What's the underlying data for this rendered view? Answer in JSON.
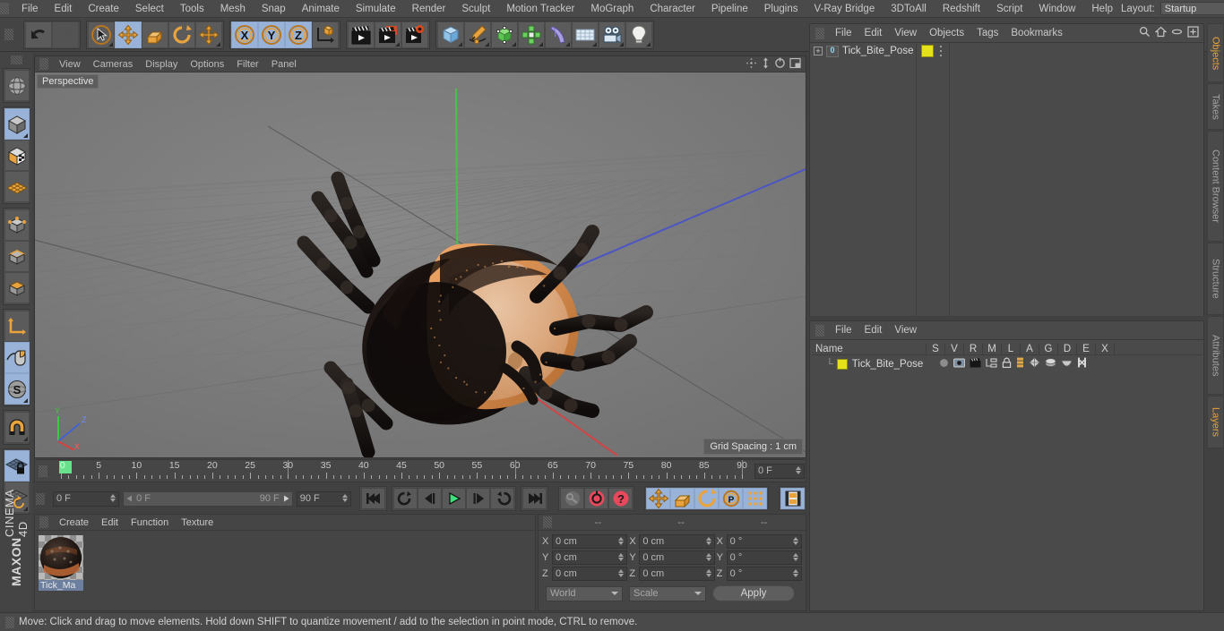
{
  "app": {
    "title": "MAXON CINEMA 4D",
    "brand_line1": "MAXON",
    "brand_line2": "CINEMA 4D"
  },
  "top_menu": {
    "items": [
      {
        "label": "File"
      },
      {
        "label": "Edit"
      },
      {
        "label": "Create"
      },
      {
        "label": "Select"
      },
      {
        "label": "Tools"
      },
      {
        "label": "Mesh"
      },
      {
        "label": "Snap"
      },
      {
        "label": "Animate"
      },
      {
        "label": "Simulate"
      },
      {
        "label": "Render"
      },
      {
        "label": "Sculpt"
      },
      {
        "label": "Motion Tracker"
      },
      {
        "label": "MoGraph"
      },
      {
        "label": "Character"
      },
      {
        "label": "Pipeline"
      },
      {
        "label": "Plugins"
      },
      {
        "label": "V-Ray Bridge"
      },
      {
        "label": "3DToAll"
      },
      {
        "label": "Redshift"
      },
      {
        "label": "Script"
      },
      {
        "label": "Window"
      },
      {
        "label": "Help"
      }
    ],
    "layout_label": "Layout:",
    "layout_value": "Startup",
    "search_icon": "magnifier-icon"
  },
  "toolbar": {
    "groups": [
      {
        "name": "history",
        "buttons": [
          {
            "name": "undo-button",
            "icon": "undo-arrow-icon",
            "active": false,
            "enabled": true,
            "corner": false
          },
          {
            "name": "redo-button",
            "icon": "redo-arrow-icon",
            "active": false,
            "enabled": false,
            "corner": false
          }
        ]
      },
      {
        "name": "transform-tools",
        "buttons": [
          {
            "name": "live-selection-tool",
            "icon": "cursor-circle-icon",
            "active": false,
            "enabled": true,
            "corner": true
          },
          {
            "name": "move-tool",
            "icon": "move-cross-icon",
            "active": true,
            "enabled": true,
            "corner": false
          },
          {
            "name": "scale-tool",
            "icon": "scale-box-icon",
            "active": false,
            "enabled": true,
            "corner": false
          },
          {
            "name": "rotate-tool",
            "icon": "rotate-circle-icon",
            "active": false,
            "enabled": true,
            "corner": false
          },
          {
            "name": "free-move-tool",
            "icon": "move-cross-icon",
            "active": false,
            "enabled": true,
            "corner": true
          }
        ]
      },
      {
        "name": "axis-locks",
        "buttons": [
          {
            "name": "lock-x-axis",
            "icon": "x-axis-icon",
            "active": true,
            "enabled": true,
            "corner": false
          },
          {
            "name": "lock-y-axis",
            "icon": "y-axis-icon",
            "active": true,
            "enabled": true,
            "corner": false
          },
          {
            "name": "lock-z-axis",
            "icon": "z-axis-icon",
            "active": true,
            "enabled": true,
            "corner": false
          },
          {
            "name": "world-object-coordinates",
            "icon": "axis-cube-icon",
            "active": false,
            "enabled": true,
            "corner": false
          }
        ]
      },
      {
        "name": "render-tools",
        "buttons": [
          {
            "name": "render-view-button",
            "icon": "clapboard-icon",
            "active": false,
            "enabled": true,
            "corner": false
          },
          {
            "name": "render-to-picture-viewer-button",
            "icon": "clapboard-window-icon",
            "active": false,
            "enabled": true,
            "corner": true
          },
          {
            "name": "render-settings-button",
            "icon": "clapboard-gear-icon",
            "active": false,
            "enabled": true,
            "corner": false
          }
        ]
      },
      {
        "name": "object-creation",
        "buttons": [
          {
            "name": "add-cube-button",
            "icon": "blue-cube-icon",
            "active": false,
            "enabled": true,
            "corner": true
          },
          {
            "name": "add-spline-button",
            "icon": "pen-spline-icon",
            "active": false,
            "enabled": true,
            "corner": true
          },
          {
            "name": "add-generator-button",
            "icon": "green-cube-icon",
            "active": false,
            "enabled": true,
            "corner": true
          },
          {
            "name": "add-array-button",
            "icon": "green-array-icon",
            "active": false,
            "enabled": true,
            "corner": true
          },
          {
            "name": "add-deformer-button",
            "icon": "bend-deformer-icon",
            "active": false,
            "enabled": true,
            "corner": true
          },
          {
            "name": "add-environment-button",
            "icon": "floor-grid-icon",
            "active": false,
            "enabled": true,
            "corner": true
          },
          {
            "name": "add-camera-button",
            "icon": "camera-icon",
            "active": false,
            "enabled": true,
            "corner": true
          },
          {
            "name": "add-light-button",
            "icon": "light-bulb-icon",
            "active": false,
            "enabled": true,
            "corner": true
          }
        ]
      }
    ]
  },
  "left_toolbar": {
    "groups": [
      {
        "name": "view-group",
        "buttons": [
          {
            "name": "make-editable-button",
            "icon": "globe-wire-icon",
            "active": false,
            "corner": false
          }
        ]
      },
      {
        "name": "mode-group",
        "buttons": [
          {
            "name": "model-mode-button",
            "icon": "grey-cube-icon",
            "active": true,
            "corner": true
          },
          {
            "name": "texture-mode-button",
            "icon": "checker-cube-icon",
            "active": false,
            "corner": false
          },
          {
            "name": "workplane-mode-button",
            "icon": "orange-grid-icon",
            "active": false,
            "corner": false
          }
        ]
      },
      {
        "name": "component-group",
        "buttons": [
          {
            "name": "points-mode-button",
            "icon": "cube-points-icon",
            "active": false,
            "corner": false
          },
          {
            "name": "edges-mode-button",
            "icon": "cube-edges-icon",
            "active": false,
            "corner": false
          },
          {
            "name": "polygons-mode-button",
            "icon": "cube-polygons-icon",
            "active": false,
            "corner": false
          }
        ]
      },
      {
        "name": "axis-group",
        "buttons": [
          {
            "name": "enable-axis-button",
            "icon": "axis-L-icon",
            "active": false,
            "corner": false
          },
          {
            "name": "enable-snapping-button",
            "icon": "mouse-icon",
            "active": true,
            "corner": false
          },
          {
            "name": "soft-selection-button",
            "icon": "s-sphere-icon",
            "active": true,
            "corner": true
          }
        ]
      },
      {
        "name": "snap-group",
        "buttons": [
          {
            "name": "magnet-tool-button",
            "icon": "magnet-icon",
            "active": false,
            "corner": true
          }
        ]
      },
      {
        "name": "workplane-group",
        "buttons": [
          {
            "name": "lock-workplane-button",
            "icon": "grid-lock-icon",
            "active": true,
            "corner": false
          },
          {
            "name": "planar-workplane-button",
            "icon": "grid-rotate-icon",
            "active": false,
            "corner": true
          }
        ]
      }
    ]
  },
  "viewport": {
    "menu": [
      {
        "label": "View"
      },
      {
        "label": "Cameras"
      },
      {
        "label": "Display"
      },
      {
        "label": "Options"
      },
      {
        "label": "Filter"
      },
      {
        "label": "Panel"
      }
    ],
    "icons": [
      "move-view-icon",
      "zoom-view-icon",
      "rotate-view-icon",
      "maximize-view-icon"
    ],
    "camera_label": "Perspective",
    "grid_spacing": "Grid Spacing : 1 cm",
    "axis_gizmo": {
      "x": "X",
      "y": "Y",
      "z": "Z",
      "x_color": "#e23b3b",
      "y_color": "#3bcf3b",
      "z_color": "#3b5fe2"
    },
    "scene_object": "Tick_Bite_Pose",
    "colors": {
      "background": "#7d7d7d",
      "grid_line": "#6f6f6f",
      "axis_x": "#d04545",
      "axis_y": "#4bbf4b",
      "axis_z": "#4b55c4",
      "body_dark": "#1a1413",
      "shield_orange": "#e3a06c",
      "shield_light": "#d9b394",
      "leg_dark": "#1c1716"
    }
  },
  "timeline": {
    "ticks": [
      0,
      5,
      10,
      15,
      20,
      25,
      30,
      35,
      40,
      45,
      50,
      55,
      60,
      65,
      70,
      75,
      80,
      85,
      90
    ],
    "min_frame": 0,
    "max_frame": 90,
    "current_frame_value": "0 F",
    "playhead_frame": 0,
    "end_field": "0 F"
  },
  "transport": {
    "current_frame": "0 F",
    "range_start": "0 F",
    "range_end": "90 F",
    "preview_end": "90 F",
    "buttons": [
      {
        "name": "go-to-start-button",
        "icon": "skip-start-icon",
        "active": false
      },
      {
        "name": "go-to-previous-keyframe-button",
        "icon": "prev-key-icon",
        "active": false
      },
      {
        "name": "step-back-button",
        "icon": "step-back-icon",
        "active": false
      },
      {
        "name": "play-button",
        "icon": "play-icon",
        "active": false
      },
      {
        "name": "step-forward-button",
        "icon": "step-forward-icon",
        "active": false
      },
      {
        "name": "go-to-next-keyframe-button",
        "icon": "next-key-icon",
        "active": false
      },
      {
        "name": "go-to-end-button",
        "icon": "skip-end-icon",
        "active": false
      }
    ],
    "key_buttons": [
      {
        "name": "record-active-objects-button",
        "icon": "key-icon",
        "active": false
      },
      {
        "name": "autokeying-button",
        "icon": "red-circle-arrow-icon",
        "active": false
      },
      {
        "name": "keyframe-selection-button",
        "icon": "red-question-icon",
        "active": false
      }
    ],
    "channel_buttons": [
      {
        "name": "record-position-button",
        "icon": "move-cross-icon",
        "active": true
      },
      {
        "name": "record-scale-button",
        "icon": "scale-box-icon",
        "active": true
      },
      {
        "name": "record-rotation-button",
        "icon": "rotate-circle-icon",
        "active": true
      },
      {
        "name": "record-parameter-button",
        "icon": "p-circle-icon",
        "active": true
      },
      {
        "name": "record-pla-button",
        "icon": "dots-grid-icon",
        "active": true
      },
      {
        "name": "keyframe-mode-button",
        "icon": "film-strip-icon",
        "active": true
      }
    ]
  },
  "materials": {
    "menu": [
      {
        "label": "Create"
      },
      {
        "label": "Edit"
      },
      {
        "label": "Function"
      },
      {
        "label": "Texture"
      }
    ],
    "items": [
      {
        "name": "Tick_Ma",
        "selected": true
      }
    ]
  },
  "coordinates": {
    "headers": [
      "--",
      "--",
      "--"
    ],
    "rows": [
      {
        "axis": "X",
        "position": "0 cm",
        "size": "0 cm",
        "rotation": "0 °"
      },
      {
        "axis": "Y",
        "position": "0 cm",
        "size": "0 cm",
        "rotation": "0 °"
      },
      {
        "axis": "Z",
        "position": "0 cm",
        "size": "0 cm",
        "rotation": "0 °"
      }
    ],
    "coord_system": "World",
    "transform_mode": "Scale",
    "apply_label": "Apply"
  },
  "objects_panel": {
    "menu": [
      {
        "label": "File"
      },
      {
        "label": "Edit"
      },
      {
        "label": "View"
      },
      {
        "label": "Objects"
      },
      {
        "label": "Tags"
      },
      {
        "label": "Bookmarks"
      }
    ],
    "icons": [
      "magnifier-icon",
      "home-icon",
      "ellipse-icon",
      "plus-box-icon"
    ],
    "rows": [
      {
        "name": "Tick_Bite_Pose",
        "icon_badge": "0",
        "tag_color": "#e5e21b",
        "expanded": false
      }
    ]
  },
  "layers_panel": {
    "menu": [
      {
        "label": "File"
      },
      {
        "label": "Edit"
      },
      {
        "label": "View"
      }
    ],
    "columns": [
      "Name",
      "S",
      "V",
      "R",
      "M",
      "L",
      "A",
      "G",
      "D",
      "E",
      "X"
    ],
    "rows": [
      {
        "name": "Tick_Bite_Pose",
        "color": "#e5e21b",
        "icons": [
          "solo-dot-icon",
          "view-icon",
          "render-icon",
          "manager-icon",
          "lock-icon",
          "animation-icon",
          "generators-icon",
          "deformers-icon",
          "expressions-icon",
          "xref-icon"
        ]
      }
    ]
  },
  "right_tabs": [
    {
      "label": "Objects",
      "active": true
    },
    {
      "label": "Takes",
      "active": false
    },
    {
      "label": "Content Browser",
      "active": false
    },
    {
      "label": "Structure",
      "active": false
    },
    {
      "label": "Attributes",
      "active": false
    },
    {
      "label": "Layers",
      "active": true
    }
  ],
  "status_bar": {
    "text": "Move: Click and drag to move elements. Hold down SHIFT to quantize movement / add to the selection in point mode, CTRL to remove."
  }
}
